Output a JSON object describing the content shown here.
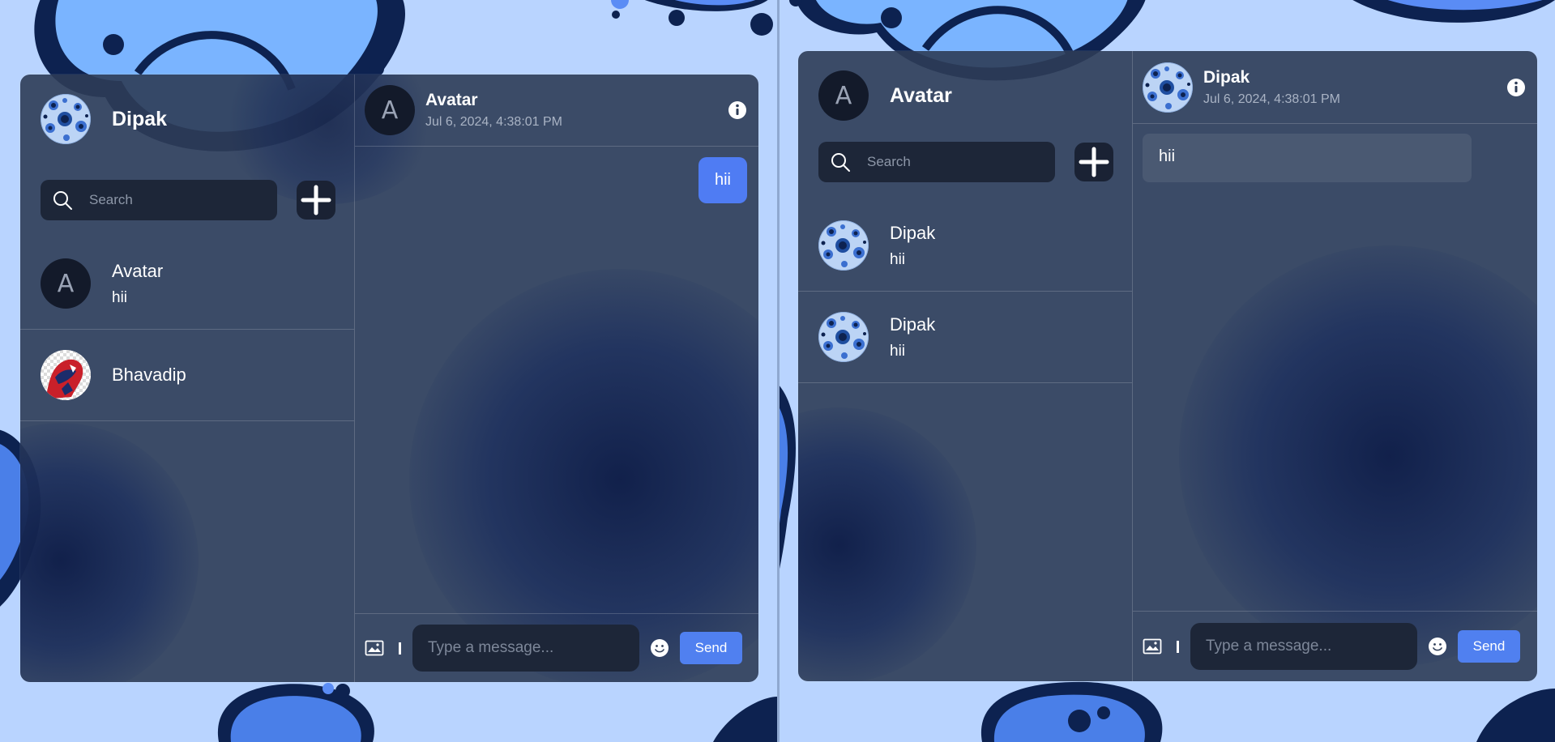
{
  "colors": {
    "background_light": "#b9d4ff",
    "panel": "#2e3c56",
    "input_bg": "#1d2638",
    "accent": "#4f7cf3",
    "blob_dark": "#0a1e5a",
    "blob_mid": "#5a8cf5"
  },
  "left": {
    "sidebar": {
      "user_name": "Dipak",
      "search_placeholder": "Search",
      "chats": [
        {
          "avatar_letter": "A",
          "name": "Avatar",
          "last_message": "hii"
        },
        {
          "name": "Bhavadip",
          "last_message": ""
        }
      ]
    },
    "chat": {
      "avatar_letter": "A",
      "title": "Avatar",
      "timestamp": "Jul 6, 2024, 4:38:01 PM",
      "messages": [
        {
          "text": "hii",
          "own": true
        }
      ],
      "input_placeholder": "Type a message...",
      "send_label": "Send"
    }
  },
  "right": {
    "sidebar": {
      "avatar_letter": "A",
      "user_name": "Avatar",
      "search_placeholder": "Search",
      "chats": [
        {
          "name": "Dipak",
          "last_message": "hii"
        },
        {
          "name": "Dipak",
          "last_message": "hii"
        }
      ]
    },
    "chat": {
      "title": "Dipak",
      "timestamp": "Jul 6, 2024, 4:38:01 PM",
      "messages": [
        {
          "text": "hii",
          "own": false
        }
      ],
      "input_placeholder": "Type a message...",
      "send_label": "Send"
    }
  }
}
